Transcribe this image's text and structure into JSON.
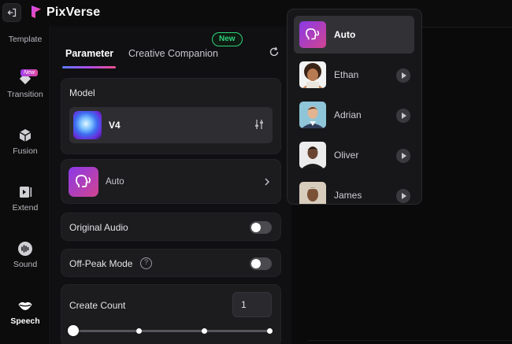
{
  "app": {
    "brand_name": "PixVerse"
  },
  "sidebar": {
    "partial_label": "Template",
    "items": [
      {
        "label": "Transition",
        "badge": "New",
        "icon": "transition-icon"
      },
      {
        "label": "Fusion",
        "icon": "cube-icon"
      },
      {
        "label": "Extend",
        "icon": "extend-icon"
      },
      {
        "label": "Sound",
        "icon": "waveform-icon"
      },
      {
        "label": "Speech",
        "icon": "lips-icon",
        "active": true
      }
    ]
  },
  "panel": {
    "tabs": [
      {
        "label": "Parameter",
        "active": true
      },
      {
        "label": "Creative Companion",
        "badge": "New"
      }
    ],
    "model": {
      "title": "Model",
      "value": "V4"
    },
    "voice": {
      "value": "Auto"
    },
    "original_audio": {
      "label": "Original Audio",
      "enabled": false
    },
    "off_peak": {
      "label": "Off-Peak Mode",
      "help": "?",
      "enabled": false
    },
    "create_count": {
      "label": "Create Count",
      "value": "1",
      "slider_position": 1,
      "slider_steps": 4
    }
  },
  "voice_dropdown": {
    "items": [
      {
        "name": "Auto",
        "selected": true
      },
      {
        "name": "Ethan"
      },
      {
        "name": "Adrian"
      },
      {
        "name": "Oliver"
      },
      {
        "name": "James"
      }
    ]
  },
  "colors": {
    "accent_green": "#2fd27a",
    "accent_purple": "#8a39e8",
    "accent_pink": "#d1448f"
  }
}
